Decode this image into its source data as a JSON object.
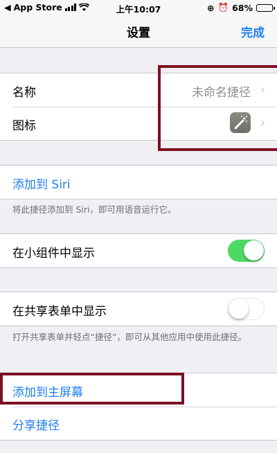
{
  "statusbar": {
    "carrier": "App Store",
    "time": "上午10:07",
    "battery": "68%",
    "battery_level": 0.68
  },
  "navbar": {
    "title": "设置",
    "done": "完成"
  },
  "settings": {
    "name_label": "名称",
    "name_value": "未命名捷径",
    "icon_label": "图标",
    "siri_label": "添加到 Siri",
    "siri_footer": "将此捷径添加到 Siri，即可用语音运行它。",
    "widget_label": "在小组件中显示",
    "widget_on": true,
    "share_sheet_label": "在共享表单中显示",
    "share_sheet_on": false,
    "share_sheet_footer": "打开共享表单并轻点“捷径”，即可从其他应用中使用此捷径。",
    "home_screen_label": "添加到主屏幕",
    "share_label": "分享捷径"
  },
  "colors": {
    "accent": "#1f7ef2",
    "toggle_on": "#4cd964",
    "highlight": "#7a1022"
  }
}
